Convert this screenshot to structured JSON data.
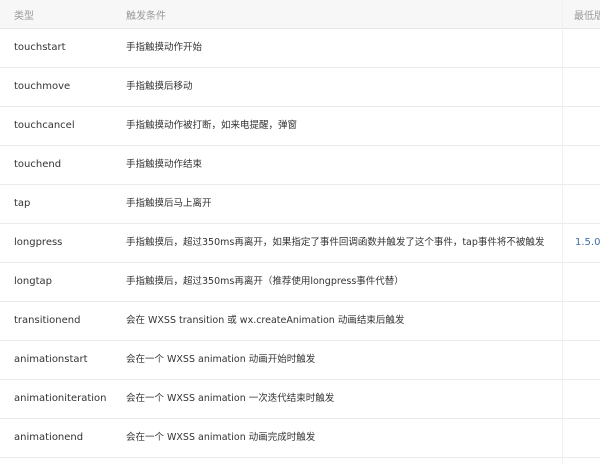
{
  "table": {
    "headers": {
      "type": "类型",
      "condition": "触发条件",
      "version": "最低版"
    },
    "rows": [
      {
        "type": "touchstart",
        "condition": "手指触摸动作开始",
        "version": ""
      },
      {
        "type": "touchmove",
        "condition": "手指触摸后移动",
        "version": ""
      },
      {
        "type": "touchcancel",
        "condition": "手指触摸动作被打断，如来电提醒，弹窗",
        "version": ""
      },
      {
        "type": "touchend",
        "condition": "手指触摸动作结束",
        "version": ""
      },
      {
        "type": "tap",
        "condition": "手指触摸后马上离开",
        "version": ""
      },
      {
        "type": "longpress",
        "condition": "手指触摸后，超过350ms再离开，如果指定了事件回调函数并触发了这个事件，tap事件将不被触发",
        "version": "1.5.0"
      },
      {
        "type": "longtap",
        "condition": "手指触摸后，超过350ms再离开（推荐使用longpress事件代替）",
        "version": ""
      },
      {
        "type": "transitionend",
        "condition": "会在 WXSS transition 或 wx.createAnimation 动画结束后触发",
        "version": ""
      },
      {
        "type": "animationstart",
        "condition": "会在一个 WXSS animation 动画开始时触发",
        "version": ""
      },
      {
        "type": "animationiteration",
        "condition": "会在一个 WXSS animation 一次迭代结束时触发",
        "version": ""
      },
      {
        "type": "animationend",
        "condition": "会在一个 WXSS animation 动画完成时触发",
        "version": ""
      }
    ]
  }
}
